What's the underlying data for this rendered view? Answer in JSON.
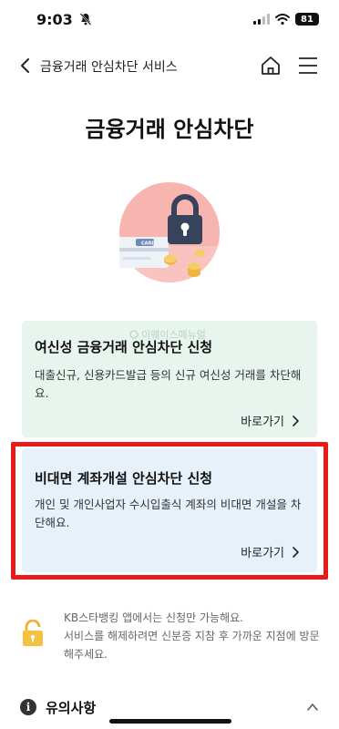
{
  "status_bar": {
    "time": "9:03",
    "battery": "81"
  },
  "nav": {
    "title": "금융거래 안심차단 서비스"
  },
  "page": {
    "title": "금융거래 안심차단"
  },
  "hero": {
    "card_label": "CARD"
  },
  "watermark": {
    "text": "이웨이스매뉴얼"
  },
  "cards": [
    {
      "title": "여신성 금융거래 안심차단 신청",
      "description": "대출신규, 신용카드발급 등의 신규 여신성 거래를 차단해요.",
      "link_label": "바로가기"
    },
    {
      "title": "비대면 계좌개설 안심차단 신청",
      "description": "개인 및 개인사업자 수시입출식 계좌의 비대면 개설을 차단해요.",
      "link_label": "바로가기"
    }
  ],
  "notice": {
    "line1": "KB스타뱅킹 앱에서는 신청만 가능해요.",
    "line2": "서비스를 해제하려면 신분증 지참 후 가까운 지점에 방문해주세요."
  },
  "caution": {
    "label": "유의사항"
  },
  "colors": {
    "highlight": "#e81a1a",
    "card_green": "#e8f4ee",
    "card_blue": "#e6f1f9",
    "coin": "#f0b43c"
  }
}
